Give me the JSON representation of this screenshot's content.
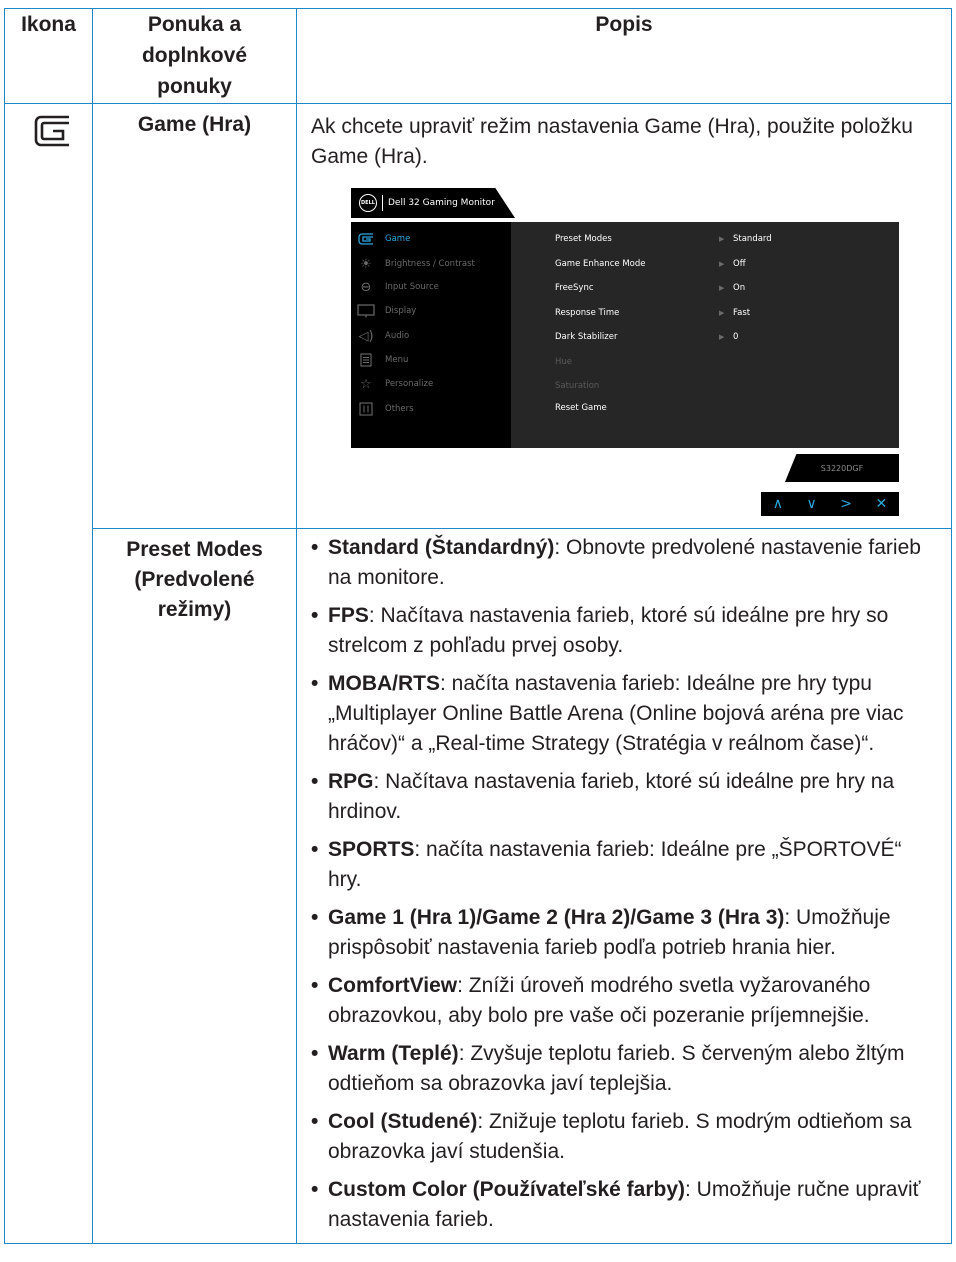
{
  "table": {
    "headers": {
      "icon": "Ikona",
      "menu": "Ponuka a doplnkové ponuky",
      "desc": "Popis"
    },
    "game_row": {
      "icon": "game-icon",
      "menu_name": "Game (Hra)",
      "description": "Ak chcete upraviť režim nastavenia Game (Hra), použite položku Game (Hra)."
    },
    "preset_row": {
      "menu_name": "Preset Modes (Predvolené režimy)",
      "items": [
        {
          "term": "Standard (Štandardný)",
          "text": ": Obnovte predvolené nastavenie farieb na monitore."
        },
        {
          "term": "FPS",
          "text": ": Načítava nastavenia farieb, ktoré sú ideálne pre hry so strelcom z pohľadu prvej osoby."
        },
        {
          "term": "MOBA/RTS",
          "text": ": načíta nastavenia farieb: Ideálne pre hry typu „Multiplayer Online Battle Arena (Online bojová aréna pre viac hráčov)“ a „Real-time Strategy (Stratégia v reálnom čase)“."
        },
        {
          "term": "RPG",
          "text": ": Načítava nastavenia farieb, ktoré sú ideálne pre hry na hrdinov."
        },
        {
          "term": "SPORTS",
          "text": ": načíta nastavenia farieb: Ideálne pre „ŠPORTOVÉ“ hry."
        },
        {
          "term": "Game 1 (Hra 1)/Game 2 (Hra 2)/Game 3 (Hra 3)",
          "text": ": Umožňuje prispôsobiť nastavenia farieb podľa potrieb hrania hier."
        },
        {
          "term": "ComfortView",
          "text": ": Zníži úroveň modrého svetla vyžarovaného obrazovkou, aby bolo pre vaše oči pozeranie príjemnejšie."
        },
        {
          "term": "Warm (Teplé)",
          "text": ": Zvyšuje teplotu farieb. S červeným alebo žltým odtieňom sa obrazovka javí teplejšia."
        },
        {
          "term": "Cool (Studené)",
          "text": ": Znižuje teplotu farieb. S modrým odtieňom sa obrazovka javí studenšia."
        },
        {
          "term": "Custom Color (Používateľské farby)",
          "text": ": Umožňuje ručne upraviť nastavenia farieb."
        }
      ]
    }
  },
  "osd": {
    "logo": "DELL",
    "title": "Dell 32 Gaming Monitor",
    "menu": [
      {
        "label": "Game",
        "icon": "game-icon",
        "active": true
      },
      {
        "label": "Brightness / Contrast",
        "icon": "brightness-icon",
        "active": false
      },
      {
        "label": "Input Source",
        "icon": "input-source-icon",
        "active": false
      },
      {
        "label": "Display",
        "icon": "display-icon",
        "active": false
      },
      {
        "label": "Audio",
        "icon": "audio-icon",
        "active": false
      },
      {
        "label": "Menu",
        "icon": "menu-icon",
        "active": false
      },
      {
        "label": "Personalize",
        "icon": "star-icon",
        "active": false
      },
      {
        "label": "Others",
        "icon": "others-icon",
        "active": false
      }
    ],
    "settings": [
      {
        "label": "Preset Modes",
        "value": "Standard",
        "dim": false
      },
      {
        "label": "Game Enhance Mode",
        "value": "Off",
        "dim": false
      },
      {
        "label": "FreeSync",
        "value": "On",
        "dim": false
      },
      {
        "label": "Response Time",
        "value": "Fast",
        "dim": false
      },
      {
        "label": "Dark Stabilizer",
        "value": "0",
        "dim": false
      },
      {
        "label": "Hue",
        "value": "",
        "dim": true
      },
      {
        "label": "Saturation",
        "value": "",
        "dim": true
      },
      {
        "label": "Reset Game",
        "value": "",
        "dim": false
      }
    ],
    "model": "S3220DGF",
    "nav": [
      "∧",
      "∨",
      ">",
      "✕"
    ],
    "accent_color": "#2aa7dc"
  },
  "colors": {
    "table_border": "#1e88c8",
    "text": "#231f20"
  }
}
